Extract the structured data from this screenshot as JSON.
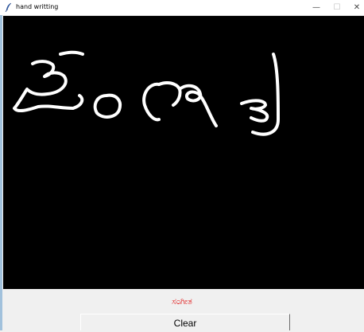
{
  "window": {
    "title": "hand writting",
    "controls": {
      "minimize": "—",
      "maximize": "☐",
      "close": "✕"
    }
  },
  "canvas": {
    "background": "#000000",
    "stroke_color": "#ffffff"
  },
  "result": {
    "text": "ಸಂಗೀತ",
    "color": "#e11f1f"
  },
  "buttons": {
    "clear_label": "Clear"
  }
}
